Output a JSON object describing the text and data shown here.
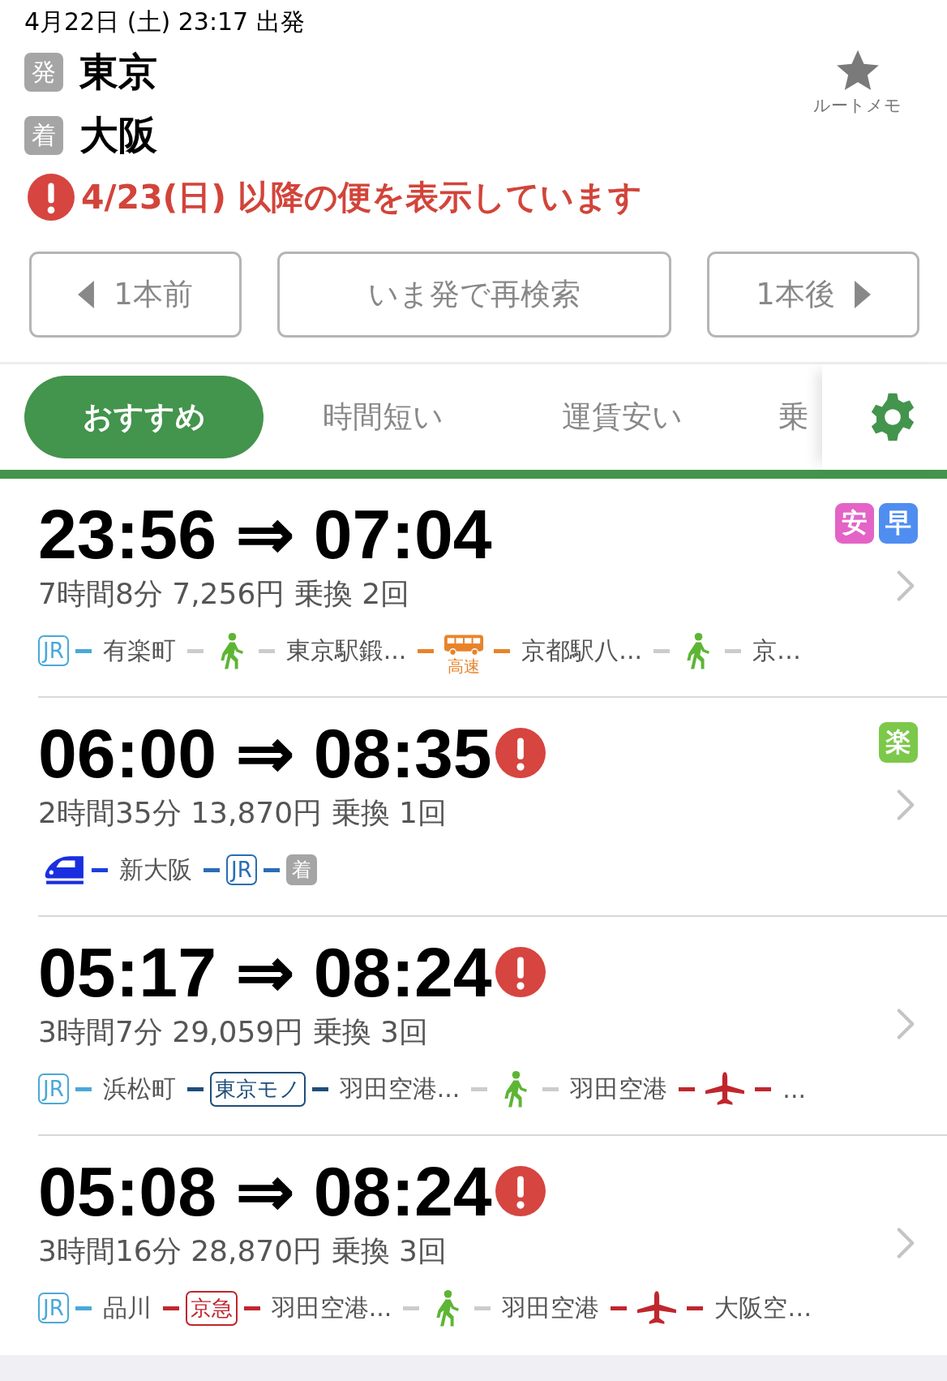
{
  "search": {
    "datetime": "4月22日 (土) 23:17 出発",
    "from_badge": "発",
    "from": "東京",
    "to_badge": "着",
    "to": "大阪",
    "memo_label": "ルートメモ",
    "notice": "4/23(日) 以降の便を表示しています"
  },
  "buttons": [
    {
      "label": "1本前",
      "kind": "prev"
    },
    {
      "label": "いま発で再検索",
      "kind": "plain"
    },
    {
      "label": "1本後",
      "kind": "next"
    }
  ],
  "tabs": [
    {
      "label": "おすすめ",
      "selected": true
    },
    {
      "label": "時間短い",
      "selected": false
    },
    {
      "label": "運賃安い",
      "selected": false
    },
    {
      "label": "乗",
      "selected": false
    }
  ],
  "routes": [
    {
      "depart": "23:56",
      "arrow": "⇒",
      "arrive": "07:04",
      "alert": false,
      "details": "7時間8分 7,256円 乗換 2回",
      "tags": [
        {
          "text": "安",
          "color": "#e463c6"
        },
        {
          "text": "早",
          "color": "#4f8ef0"
        }
      ],
      "segments": [
        {
          "kind": "badge",
          "text": "JR",
          "color": "#4aa8d8"
        },
        {
          "kind": "line",
          "color": "#4aa8d8"
        },
        {
          "kind": "station",
          "text": "有楽町"
        },
        {
          "kind": "line",
          "color": "#cccccc"
        },
        {
          "kind": "walk"
        },
        {
          "kind": "line",
          "color": "#cccccc"
        },
        {
          "kind": "station",
          "text": "東京駅鍛..."
        },
        {
          "kind": "line",
          "color": "#e8832a"
        },
        {
          "kind": "bus",
          "text": "高速"
        },
        {
          "kind": "line",
          "color": "#e8832a"
        },
        {
          "kind": "station",
          "text": "京都駅八..."
        },
        {
          "kind": "line",
          "color": "#cccccc"
        },
        {
          "kind": "walk"
        },
        {
          "kind": "line",
          "color": "#cccccc"
        },
        {
          "kind": "station",
          "text": "京…"
        }
      ]
    },
    {
      "depart": "06:00",
      "arrow": "⇒",
      "arrive": "08:35",
      "alert": true,
      "details": "2時間35分 13,870円 乗換 1回",
      "tags": [
        {
          "text": "楽",
          "color": "#7cc84a"
        }
      ],
      "segments": [
        {
          "kind": "shinkansen"
        },
        {
          "kind": "line",
          "color": "#1a3fe0"
        },
        {
          "kind": "station",
          "text": "新大阪"
        },
        {
          "kind": "line",
          "color": "#2a6db5"
        },
        {
          "kind": "badge",
          "text": "JR",
          "color": "#2a6db5"
        },
        {
          "kind": "line",
          "color": "#2a6db5"
        },
        {
          "kind": "arrival",
          "text": "着"
        }
      ]
    },
    {
      "depart": "05:17",
      "arrow": "⇒",
      "arrive": "08:24",
      "alert": true,
      "details": "3時間7分 29,059円 乗換 3回",
      "segments": [
        {
          "kind": "badge",
          "text": "JR",
          "color": "#4aa8d8"
        },
        {
          "kind": "line",
          "color": "#4aa8d8"
        },
        {
          "kind": "station",
          "text": "浜松町"
        },
        {
          "kind": "line",
          "color": "#1f4e79"
        },
        {
          "kind": "badge",
          "text": "東京モノ",
          "color": "#1f4e79"
        },
        {
          "kind": "line",
          "color": "#1f4e79"
        },
        {
          "kind": "station",
          "text": "羽田空港..."
        },
        {
          "kind": "line",
          "color": "#cccccc"
        },
        {
          "kind": "walk"
        },
        {
          "kind": "line",
          "color": "#cccccc"
        },
        {
          "kind": "station",
          "text": "羽田空港"
        },
        {
          "kind": "line",
          "color": "#c0262d"
        },
        {
          "kind": "plane"
        },
        {
          "kind": "line",
          "color": "#c0262d"
        },
        {
          "kind": "station",
          "text": "..."
        }
      ]
    },
    {
      "depart": "05:08",
      "arrow": "⇒",
      "arrive": "08:24",
      "alert": true,
      "details": "3時間16分 28,870円 乗換 3回",
      "segments": [
        {
          "kind": "badge",
          "text": "JR",
          "color": "#4aa8d8"
        },
        {
          "kind": "line",
          "color": "#4aa8d8"
        },
        {
          "kind": "station",
          "text": "品川"
        },
        {
          "kind": "line",
          "color": "#c0262d"
        },
        {
          "kind": "badge",
          "text": "京急",
          "color": "#c0262d"
        },
        {
          "kind": "line",
          "color": "#c0262d"
        },
        {
          "kind": "station",
          "text": "羽田空港..."
        },
        {
          "kind": "line",
          "color": "#cccccc"
        },
        {
          "kind": "walk"
        },
        {
          "kind": "line",
          "color": "#cccccc"
        },
        {
          "kind": "station",
          "text": "羽田空港"
        },
        {
          "kind": "line",
          "color": "#c0262d"
        },
        {
          "kind": "plane"
        },
        {
          "kind": "line",
          "color": "#c0262d"
        },
        {
          "kind": "station",
          "text": "大阪空…"
        }
      ]
    }
  ]
}
